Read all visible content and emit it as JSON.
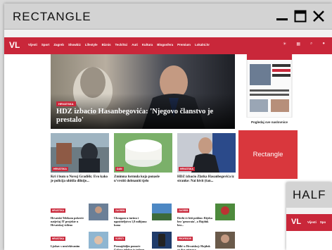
{
  "window": {
    "title": "RECTANGLE"
  },
  "site": {
    "logo": "VL",
    "nav": [
      "Vijesti",
      "Sport",
      "Zagreb",
      "Showbiz",
      "Lifestyle",
      "Biznis",
      "Tech/Sci",
      "Auti",
      "Kultura",
      "Blogosfera",
      "Premium",
      "Lokalni.hr"
    ]
  },
  "hero": {
    "badge": "HRVATSKA",
    "headline": "HDZ izbacio Hasanbegovića: 'Njegovo članstvo je prestalo'"
  },
  "sidebar": {
    "caption": "Pogledaj sve naslovnice"
  },
  "ad": {
    "label": "Rectangle"
  },
  "cards": [
    {
      "tag": "HRVATSKA",
      "title": "Kri i bum u Novoj Gradišk: Evo kako je policija uhitila dilnije..."
    },
    {
      "tag": "DAN",
      "title": "Zmimna formula koja ponasle u'vrstiti dobnaniti tjelo"
    },
    {
      "tag": "HRVATSKA",
      "title": "HDZ izbacio Zlatka Hasanbegovića iz stranke: Nai hivit (šan..."
    }
  ],
  "minis": [
    {
      "tag": "HRVATSKA",
      "text": "Hrvatski Telekom pokreće natječaj IT projekte u Hrvatskoj viđeno"
    },
    {
      "tag": "ZAGREB",
      "text": "Uhragam u turinu i ugostiteljstvu 1,8 milijuna kuna"
    },
    {
      "tag": "ZAGREB",
      "text": "Derbi će biti poklon: Rijeka bez 'genovata', a Hajduk bez..."
    },
    {
      "tag": "HRVATSKA",
      "text": "Ljubav s neočekivanim"
    },
    {
      "tag": "VIJESTI",
      "text": "Pronajdoljin pomoće Galaxy telefon iz jednog"
    },
    {
      "tag": "PROFESOR",
      "text": "Bilić u Hrvatskoj: Hajduk za dva mjeseca"
    }
  ],
  "half": {
    "title": "HALF",
    "logo": "VL",
    "nav": [
      "Vijesti",
      "Spo"
    ]
  }
}
